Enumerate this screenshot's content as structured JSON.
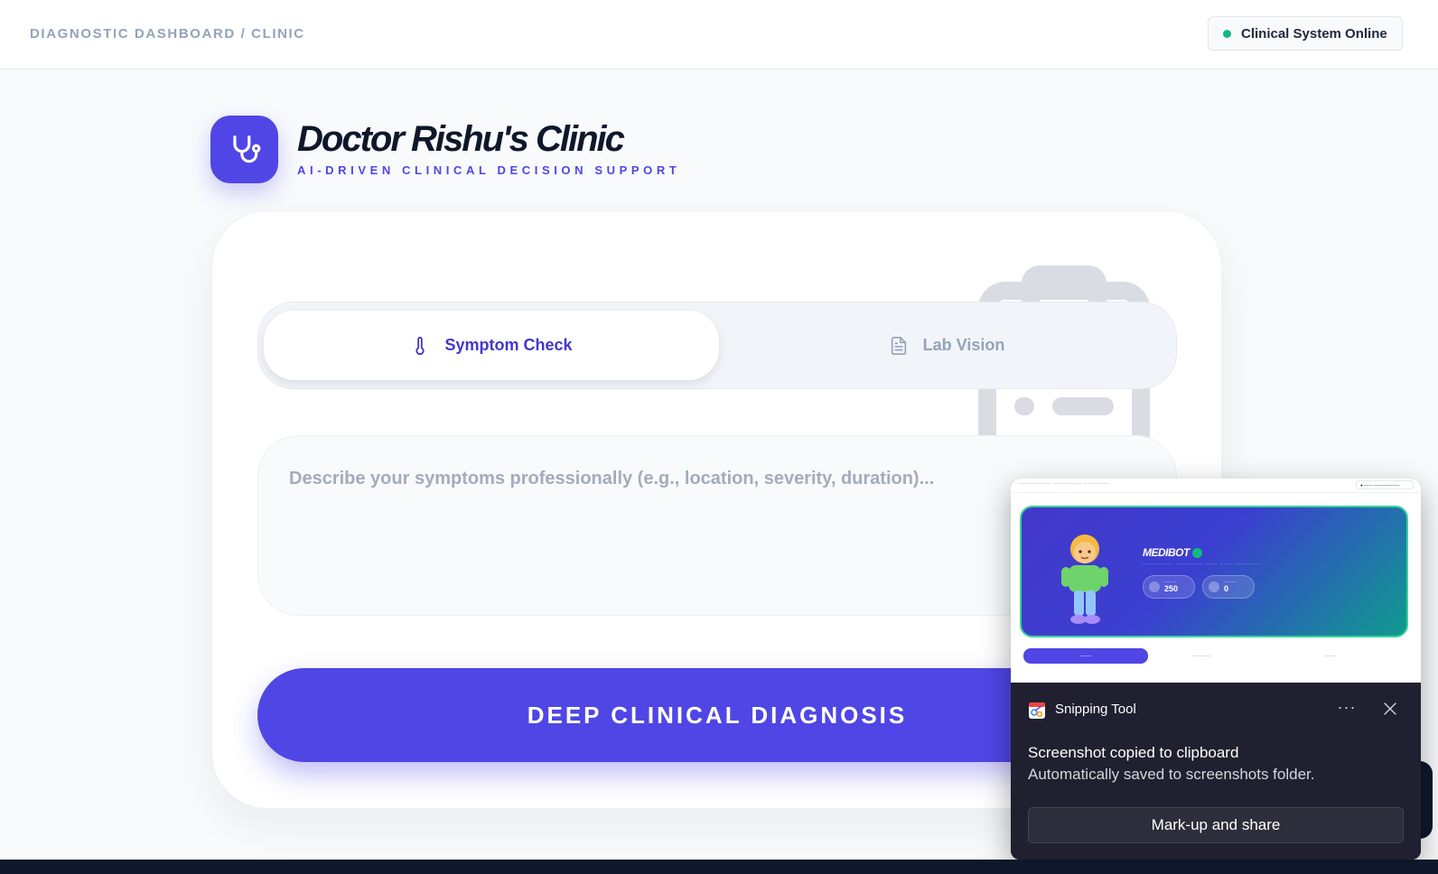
{
  "header": {
    "breadcrumb": "DIAGNOSTIC DASHBOARD / CLINIC",
    "status": "Clinical System Online",
    "status_color": "#10b981"
  },
  "brand": {
    "title": "Doctor Rishu's Clinic",
    "subtitle": "AI-DRIVEN CLINICAL DECISION SUPPORT",
    "logo_icon": "stethoscope-icon",
    "accent": "#4f46e5"
  },
  "tabs": [
    {
      "label": "Symptom Check",
      "icon": "thermometer-icon",
      "active": true
    },
    {
      "label": "Lab Vision",
      "icon": "document-icon",
      "active": false
    }
  ],
  "symptom_input": {
    "placeholder": "Describe your symptoms professionally (e.g., location, severity, duration)...",
    "value": ""
  },
  "action": {
    "diagnose_label": "DEEP CLINICAL DIAGNOSIS"
  },
  "snipping_tool": {
    "app_name": "Snipping Tool",
    "message_title": "Screenshot copied to clipboard",
    "message_detail": "Automatically saved to screenshots folder.",
    "action_label": "Mark-up and share",
    "more_label": "···",
    "preview": {
      "title": "MEDIBOT",
      "stats": [
        {
          "value": "250"
        },
        {
          "value": "0"
        }
      ]
    }
  }
}
